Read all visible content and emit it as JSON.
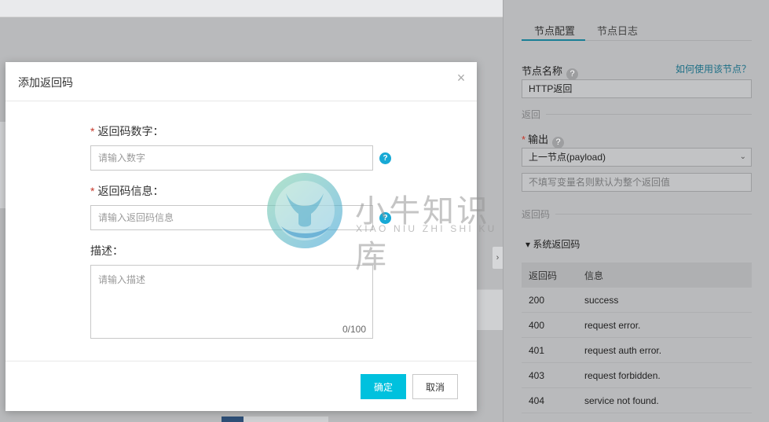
{
  "panel": {
    "tabs": [
      {
        "label": "节点配置",
        "active": true
      },
      {
        "label": "节点日志",
        "active": false
      }
    ],
    "node_name_label": "节点名称",
    "help_link": "如何使用该节点？",
    "node_name_value": "HTTP返回",
    "section_return": "返回",
    "output_label": "输出",
    "output_select": "上一节点(payload)",
    "output_var_placeholder": "不填写变量名则默认为整个返回值",
    "section_codes": "返回码",
    "system_codes_title": "系统返回码",
    "table_headers": {
      "code": "返回码",
      "info": "信息"
    },
    "codes": [
      {
        "code": "200",
        "info": "success"
      },
      {
        "code": "400",
        "info": "request error."
      },
      {
        "code": "401",
        "info": "request auth error."
      },
      {
        "code": "403",
        "info": "request forbidden."
      },
      {
        "code": "404",
        "info": "service not found."
      }
    ]
  },
  "dialog": {
    "title": "添加返回码",
    "code_label": "返回码数字：",
    "code_placeholder": "请输入数字",
    "msg_label": "返回码信息：",
    "msg_placeholder": "请输入返回码信息",
    "desc_label": "描述：",
    "desc_placeholder": "请输入描述",
    "desc_counter": "0/100",
    "ok_label": "确定",
    "cancel_label": "取消"
  },
  "watermark": {
    "cn": "小牛知识库",
    "en": "XIAO NIU ZHI SHI KU"
  },
  "colors": {
    "primary": "#00c1de",
    "help_blue": "#17a9d5",
    "required": "#e4393c"
  }
}
